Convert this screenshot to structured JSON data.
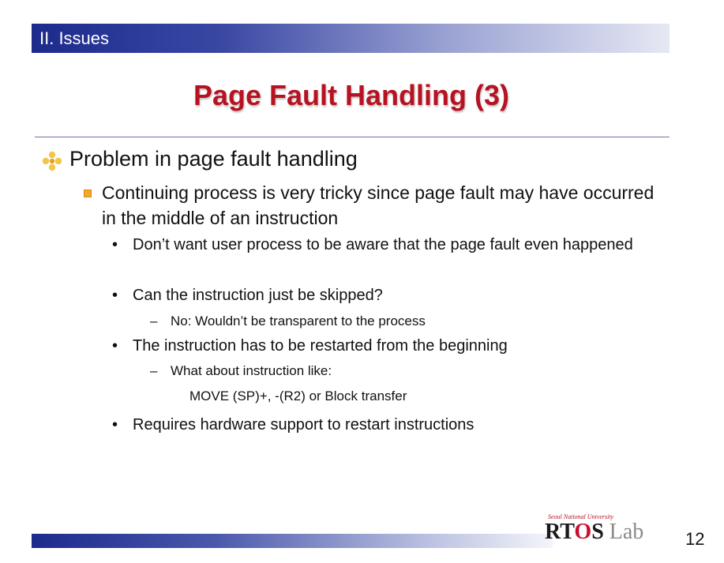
{
  "header": {
    "section": "II. Issues"
  },
  "title": "Page Fault Handling (3)",
  "content": {
    "l1": "Problem in page fault handling",
    "l2": "Continuing process is very tricky since page fault may have occurred in the middle of an instruction",
    "b1": "Don’t want user process to be aware that the page fault even happened",
    "b2": "Can the instruction just be skipped?",
    "b2_sub": "No: Wouldn’t be transparent to the process",
    "b3": "The instruction has to be restarted from the beginning",
    "b3_sub": "What about instruction like:",
    "b3_sub_cont": "MOVE (SP)+, -(R2) or Block transfer",
    "b4": "Requires hardware support to restart instructions",
    "bullet_glyph": "•",
    "dash_glyph": "–"
  },
  "footer": {
    "logo_univ": "Seoul National University",
    "logo_r": "RT",
    "logo_o": "O",
    "logo_s": "S",
    "logo_lab": " Lab",
    "page_number": "12"
  },
  "colors": {
    "title": "#b71221",
    "bar": "#1c2a8c",
    "bullet_square": "#f0a830"
  },
  "icons": {
    "l1": "diamond-bullet-icon",
    "l2": "square-bullet-icon",
    "l3": "dot-bullet-icon",
    "l4": "dash-bullet-icon"
  }
}
